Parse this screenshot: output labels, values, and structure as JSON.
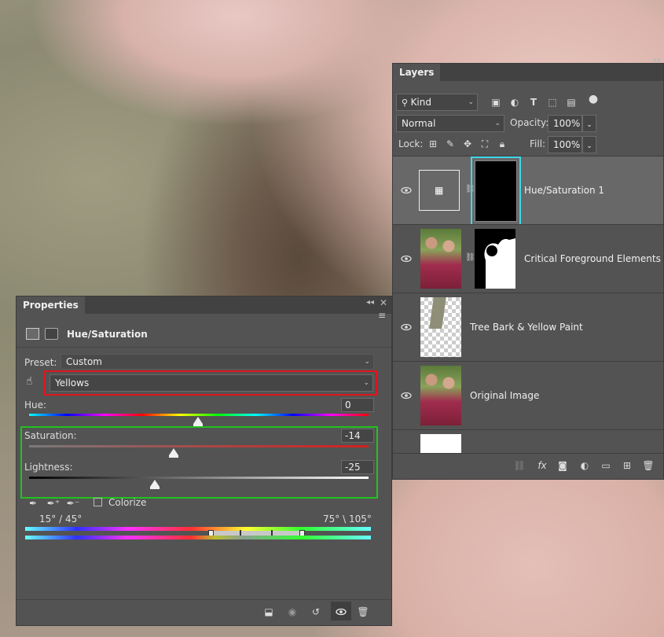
{
  "layers_panel": {
    "tab": "Layers",
    "filter_kind": "Kind",
    "blend_mode": "Normal",
    "opacity_label": "Opacity:",
    "opacity_value": "100%",
    "lock_label": "Lock:",
    "fill_label": "Fill:",
    "fill_value": "100%",
    "layers": [
      {
        "name": "Hue/Saturation 1",
        "selected": true
      },
      {
        "name": "Critical Foreground Elements",
        "selected": false
      },
      {
        "name": "Tree Bark & Yellow Paint",
        "selected": false
      },
      {
        "name": "Original Image",
        "selected": false
      }
    ]
  },
  "properties_panel": {
    "tab": "Properties",
    "adjustment_title": "Hue/Saturation",
    "preset_label": "Preset:",
    "preset_value": "Custom",
    "channel_value": "Yellows",
    "hue_label": "Hue:",
    "hue_value": "0",
    "saturation_label": "Saturation:",
    "saturation_value": "-14",
    "lightness_label": "Lightness:",
    "lightness_value": "-25",
    "colorize_label": "Colorize",
    "range_left": "15° / 45°",
    "range_right": "75° \\ 105°"
  },
  "colors": {
    "panel_bg": "#535353",
    "selection_highlight_red": "#e0141c",
    "selection_highlight_green": "#22c21f",
    "mask_border_cyan": "#3fd6ea"
  }
}
